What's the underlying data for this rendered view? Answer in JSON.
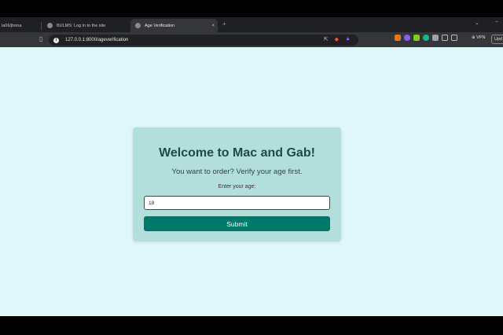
{
  "tabs": [
    {
      "title": "ia06/jhona",
      "active": false
    },
    {
      "title": "BULMS: Log in to the site",
      "active": false
    },
    {
      "title": "Age Verification",
      "active": true
    }
  ],
  "tab_close": "×",
  "new_tab": "+",
  "tab_menu": "⌄",
  "window_min": "−",
  "address": {
    "url": "127.0.0.1:8000/ageverification"
  },
  "extensions": {
    "vpn_label": "VPN",
    "update_label": "Upd"
  },
  "page": {
    "heading": "Welcome to Mac and Gab!",
    "subtitle": "You want to order? Verify your age first.",
    "age_label": "Enter your age:",
    "age_value": "18",
    "submit_label": "Submit"
  },
  "colors": {
    "page_bg": "#e0f7fa",
    "card_bg": "#b2dfdb",
    "button_bg": "#00796b",
    "heading": "#1b4d45"
  }
}
